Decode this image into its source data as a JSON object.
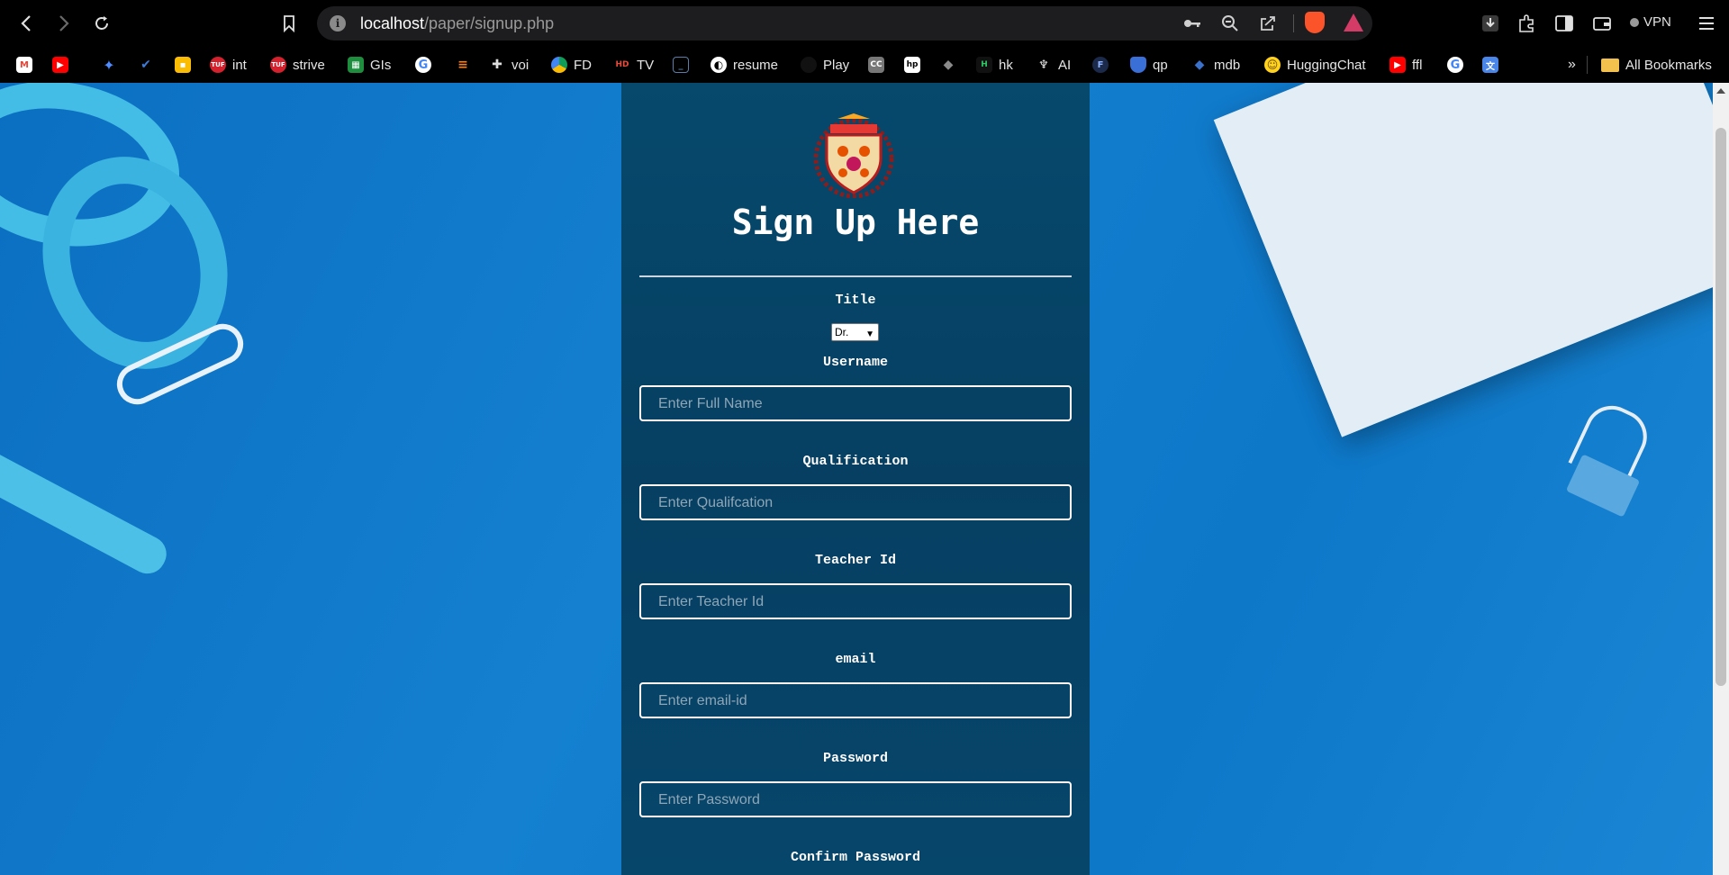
{
  "browser": {
    "url_host": "localhost",
    "url_path": "/paper/signup.php",
    "vpn_label": "VPN",
    "bookmarks": [
      {
        "label": "",
        "icon": "gmail-icon"
      },
      {
        "label": "",
        "icon": "youtube-icon"
      },
      {
        "label": "",
        "icon": "gemini-icon"
      },
      {
        "label": "",
        "icon": "checkmark-icon"
      },
      {
        "label": "",
        "icon": "keep-icon"
      },
      {
        "label": "int",
        "icon": "tuf-icon"
      },
      {
        "label": "strive",
        "icon": "tuf-icon"
      },
      {
        "label": "GIs",
        "icon": "sheets-icon"
      },
      {
        "label": "",
        "icon": "google-icon"
      },
      {
        "label": "",
        "icon": "stackoverflow-icon"
      },
      {
        "label": "voi",
        "icon": "puzzle-icon"
      },
      {
        "label": "FD",
        "icon": "drive-icon"
      },
      {
        "label": "TV",
        "icon": "tv-icon"
      },
      {
        "label": "",
        "icon": "code-icon"
      },
      {
        "label": "resume",
        "icon": "globe-icon"
      },
      {
        "label": "Play",
        "icon": "play-icon"
      },
      {
        "label": "",
        "icon": "cc-icon"
      },
      {
        "label": "",
        "icon": "hp-icon"
      },
      {
        "label": "",
        "icon": "layers-icon"
      },
      {
        "label": "hk",
        "icon": "hackerrank-icon"
      },
      {
        "label": "AI",
        "icon": "arm-icon"
      },
      {
        "label": "",
        "icon": "f-icon"
      },
      {
        "label": "qp",
        "icon": "shield-icon"
      },
      {
        "label": "mdb",
        "icon": "diamond-icon"
      },
      {
        "label": "HuggingChat",
        "icon": "hugging-icon"
      },
      {
        "label": "ffl",
        "icon": "youtube-icon"
      },
      {
        "label": "",
        "icon": "google-icon"
      },
      {
        "label": "",
        "icon": "translate-icon"
      }
    ],
    "all_bookmarks_label": "All Bookmarks",
    "overflow_label": "»"
  },
  "form": {
    "heading": "Sign Up Here",
    "title_label": "Title",
    "title_value": "Dr.",
    "username_label": "Username",
    "username_placeholder": "Enter Full Name",
    "qualification_label": "Qualification",
    "qualification_placeholder": "Enter Qualifcation",
    "teacher_id_label": "Teacher Id",
    "teacher_id_placeholder": "Enter Teacher Id",
    "email_label": "email",
    "email_placeholder": "Enter email-id",
    "password_label": "Password",
    "password_placeholder": "Enter Password",
    "confirm_password_label": "Confirm Password"
  },
  "colors": {
    "panel": "#063f62",
    "page_background": "#0d77c8",
    "brave": "#fb542b"
  }
}
